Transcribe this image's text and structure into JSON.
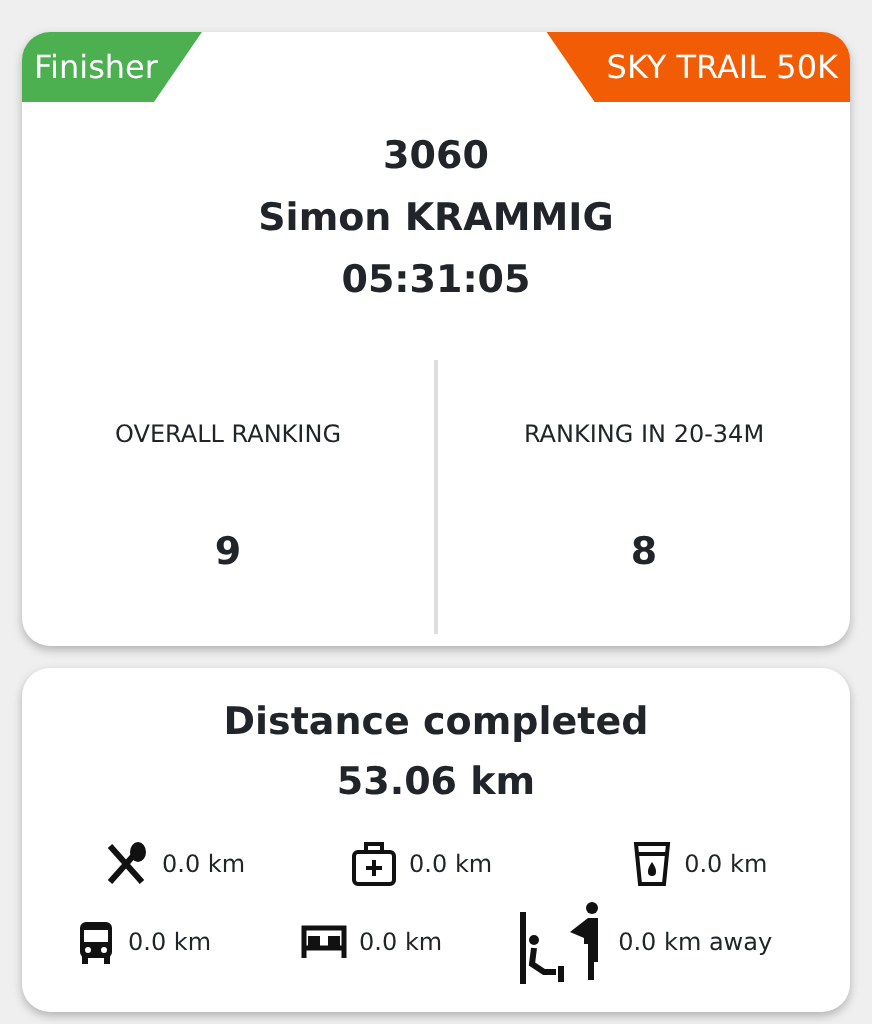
{
  "status_badge": "Finisher",
  "race_badge": "SKY TRAIL 50K",
  "bib": "3060",
  "runner_name": "Simon KRAMMIG",
  "finish_time": "05:31:05",
  "rankings": [
    {
      "label": "OVERALL RANKING",
      "value": "9"
    },
    {
      "label": "RANKING IN 20-34M",
      "value": "8"
    }
  ],
  "distance": {
    "title": "Distance completed",
    "value": "53.06 km"
  },
  "services": [
    [
      {
        "kind": "food",
        "text": "0.0 km"
      },
      {
        "kind": "medical",
        "text": "0.0 km"
      },
      {
        "kind": "water",
        "text": "0.0 km"
      }
    ],
    [
      {
        "kind": "bus",
        "text": "0.0 km"
      },
      {
        "kind": "bed",
        "text": "0.0 km"
      },
      {
        "kind": "assist",
        "text": "0.0 km away"
      }
    ]
  ]
}
